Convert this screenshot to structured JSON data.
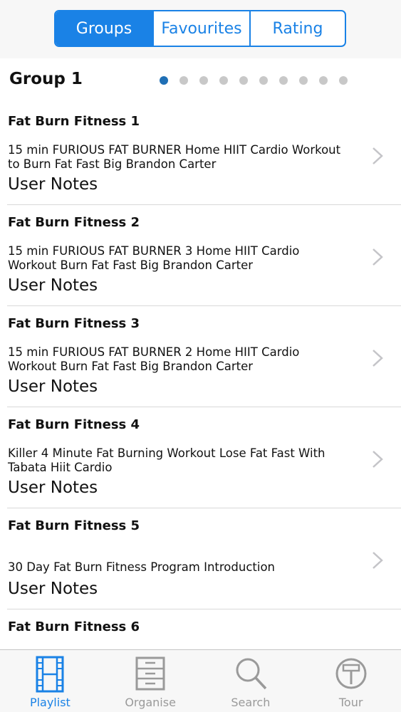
{
  "segmented": {
    "items": [
      {
        "label": "Groups",
        "active": true
      },
      {
        "label": "Favourites",
        "active": false
      },
      {
        "label": "Rating",
        "active": false
      }
    ]
  },
  "group": {
    "title": "Group 1",
    "page_count": 10,
    "current_page": 1
  },
  "rows": [
    {
      "title": "Fat Burn Fitness 1",
      "desc": "15 min FURIOUS FAT BURNER Home HIIT Cardio Workout to Burn Fat Fast Big Brandon Carter",
      "notes": "User Notes"
    },
    {
      "title": "Fat Burn Fitness 2",
      "desc": "15 min FURIOUS FAT BURNER 3 Home HIIT Cardio Workout  Burn Fat Fast Big Brandon Carter",
      "notes": "User Notes"
    },
    {
      "title": "Fat Burn Fitness 3",
      "desc": "15 min FURIOUS FAT BURNER 2 Home HIIT Cardio Workout  Burn Fat Fast Big Brandon Carter",
      "notes": "User Notes"
    },
    {
      "title": "Fat Burn Fitness 4",
      "desc": "Killer 4 Minute Fat Burning Workout Lose Fat Fast With Tabata  Hiit Cardio",
      "notes": "User Notes"
    },
    {
      "title": "Fat Burn Fitness 5",
      "desc": "30 Day Fat Burn Fitness Program Introduction",
      "notes": "User Notes"
    },
    {
      "title": "Fat Burn Fitness 6",
      "desc": "",
      "notes": ""
    }
  ],
  "tabs": [
    {
      "label": "Playlist",
      "icon": "film-strip-icon",
      "active": true
    },
    {
      "label": "Organise",
      "icon": "cabinet-icon",
      "active": false
    },
    {
      "label": "Search",
      "icon": "magnifier-icon",
      "active": false
    },
    {
      "label": "Tour",
      "icon": "signpost-icon",
      "active": false
    }
  ],
  "colors": {
    "accent": "#1a82e6",
    "inactive_tab": "#9a9a9a",
    "dot_active": "#1f6fb5",
    "dot_inactive": "#c8c8c8"
  }
}
